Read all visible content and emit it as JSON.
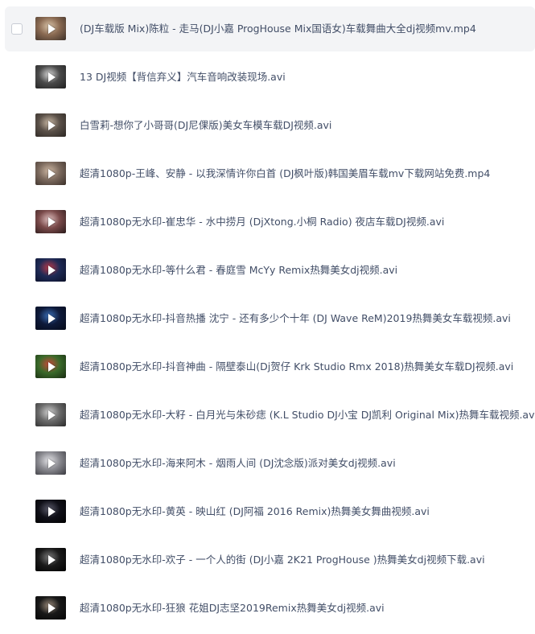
{
  "files": [
    {
      "name": "(DJ车载版 Mix)陈粒 - 走马(DJ小嘉 ProgHouse Mix国语女)车载舞曲大全dj视频mv.mp4",
      "thumb_colors": [
        "#8a6a52",
        "#d8c3a8",
        "#3c3028"
      ]
    },
    {
      "name": "13 DJ视频【背信弃义】汽车音响改装现场.avi",
      "thumb_colors": [
        "#4a4a4a",
        "#d6d6d6",
        "#202020"
      ]
    },
    {
      "name": "白雪莉-想你了小哥哥(DJ尼倮版)美女车模车载DJ视频.avi",
      "thumb_colors": [
        "#5a5048",
        "#c9b8a4",
        "#2b2622"
      ]
    },
    {
      "name": "超清1080p-王峰、安静 - 以我深情许你白首 (DJ枫叶版)韩国美眉车载mv下载网站免费.mp4",
      "thumb_colors": [
        "#7c6a5e",
        "#cdb7a3",
        "#3a2f29"
      ]
    },
    {
      "name": "超清1080p无水印-崔忠华 - 水中捞月   (DjXtong.小桐 Radio)  夜店车载DJ视频.avi",
      "thumb_colors": [
        "#7a4a4a",
        "#e0c0c0",
        "#2a1a1a"
      ]
    },
    {
      "name": "超清1080p无水印-等什么君 - 春庭雪 McYy Remix热舞美女dj视频.avi",
      "thumb_colors": [
        "#1e2a55",
        "#b83a4a",
        "#0c1028"
      ]
    },
    {
      "name": "超清1080p无水印-抖音热播 沈宁 - 还有多少个十年 (DJ Wave ReM)2019热舞美女车载视频.avi",
      "thumb_colors": [
        "#0e1a3a",
        "#3b6fb8",
        "#050a18"
      ]
    },
    {
      "name": "超清1080p无水印-抖音神曲 - 隔壁泰山(Dj贺仔 Krk Studio Rmx 2018)热舞美女车载DJ视频.avi",
      "thumb_colors": [
        "#3a6a2a",
        "#c84a3a",
        "#182a10"
      ]
    },
    {
      "name": "超清1080p无水印-大籽 - 白月光与朱砂痣 (K.L Studio DJ小宝 DJ凯利 Original Mix)热舞车载视频.avi",
      "thumb_colors": [
        "#6a6a6a",
        "#d0d0d0",
        "#2a2a2a"
      ]
    },
    {
      "name": "超清1080p无水印-海来阿木 - 烟雨人间 (DJ沈念版)派对美女dj视频.avi",
      "thumb_colors": [
        "#8a8a90",
        "#e4e4e8",
        "#3a3a40"
      ]
    },
    {
      "name": "超清1080p无水印-黄英 - 映山红 (DJ阿福 2016 Remix)热舞美女舞曲视频.avi",
      "thumb_colors": [
        "#101018",
        "#5a5a6a",
        "#000000"
      ]
    },
    {
      "name": "超清1080p无水印-欢子 - 一个人的街   (DJ小嘉 2K21 ProgHouse )热舞美女dj视频下载.avi",
      "thumb_colors": [
        "#1a1a1a",
        "#7a7a7a",
        "#000000"
      ]
    },
    {
      "name": "超清1080p无水印-狂狼 花姐DJ志坚2019Remix热舞美女dj视频.avi",
      "thumb_colors": [
        "#181818",
        "#9a8a7a",
        "#050505"
      ]
    }
  ]
}
